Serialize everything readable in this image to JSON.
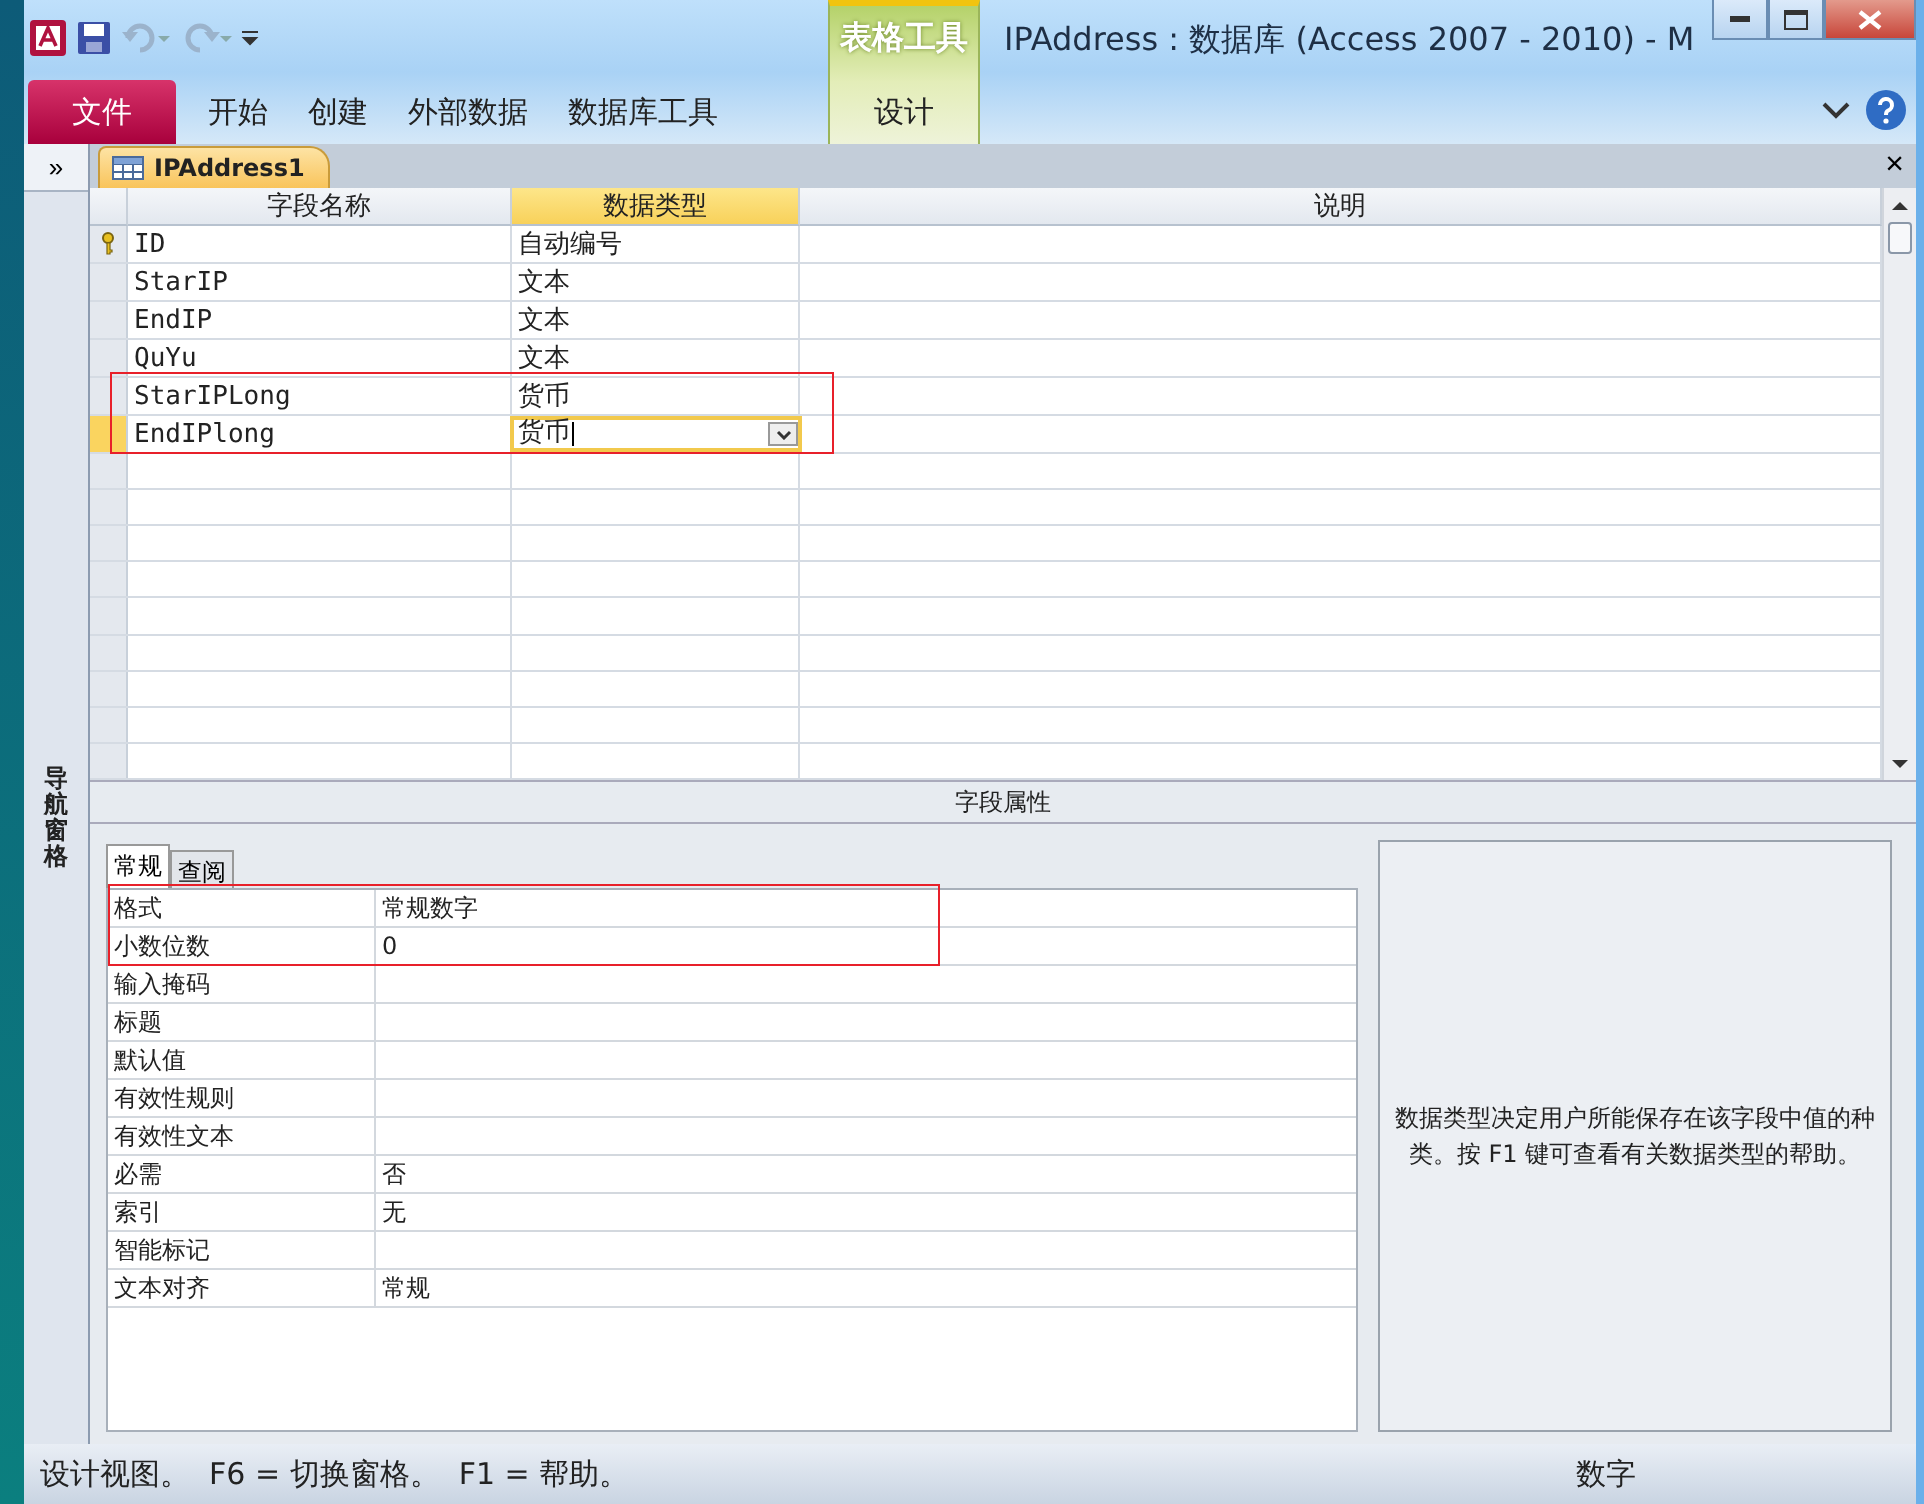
{
  "window": {
    "title": "IPAddress : 数据库 (Access 2007 - 2010)  -  M",
    "context_group": "表格工具"
  },
  "ribbon_tabs": [
    {
      "label": "文件",
      "kind": "file",
      "selected": false
    },
    {
      "label": "开始",
      "kind": "normal",
      "selected": false
    },
    {
      "label": "创建",
      "kind": "normal",
      "selected": false
    },
    {
      "label": "外部数据",
      "kind": "normal",
      "selected": false
    },
    {
      "label": "数据库工具",
      "kind": "normal",
      "selected": false
    },
    {
      "label": "设计",
      "kind": "contextual",
      "selected": false
    }
  ],
  "nav_pane": {
    "toggle": "»",
    "title": "导航窗格"
  },
  "document_tab": {
    "title": "IPAddress1",
    "close": "×"
  },
  "fields_table": {
    "columns": [
      "字段名称",
      "数据类型",
      "说明"
    ],
    "rows": [
      {
        "name": "ID",
        "type": "自动编号",
        "primary_key": true,
        "selected": false,
        "annotated": false
      },
      {
        "name": "StarIP",
        "type": "文本",
        "primary_key": false,
        "selected": false,
        "annotated": false
      },
      {
        "name": "EndIP",
        "type": "文本",
        "primary_key": false,
        "selected": false,
        "annotated": false
      },
      {
        "name": "QuYu",
        "type": "文本",
        "primary_key": false,
        "selected": false,
        "annotated": false
      },
      {
        "name": "StarIPLong",
        "type": "货币",
        "primary_key": false,
        "selected": false,
        "annotated": true
      },
      {
        "name": "EndIPlong",
        "type": "货币",
        "primary_key": false,
        "selected": true,
        "annotated": true
      }
    ]
  },
  "field_properties": {
    "title": "字段属性",
    "tabs": [
      {
        "label": "常规",
        "selected": true
      },
      {
        "label": "查阅",
        "selected": false
      }
    ],
    "rows": [
      {
        "label": "格式",
        "value": "常规数字",
        "annotated": true
      },
      {
        "label": "小数位数",
        "value": "0",
        "annotated": true
      },
      {
        "label": "输入掩码",
        "annotated": false
      },
      {
        "label": "标题",
        "annotated": false
      },
      {
        "label": "默认值",
        "annotated": false
      },
      {
        "label": "有效性规则",
        "annotated": false
      },
      {
        "label": "有效性文本",
        "annotated": false
      },
      {
        "label": "必需",
        "value": "否",
        "annotated": false
      },
      {
        "label": "索引",
        "value": "无",
        "annotated": false
      },
      {
        "label": "智能标记",
        "annotated": false
      },
      {
        "label": "文本对齐",
        "value": "常规",
        "annotated": false
      }
    ],
    "help": "数据类型决定用户所能保存在该字段中值的种类。按 F1 键可查看有关数据类型的帮助。"
  },
  "status_bar": {
    "message": "设计视图。  F6 = 切换窗格。  F1 = 帮助。",
    "mode": "数字"
  }
}
